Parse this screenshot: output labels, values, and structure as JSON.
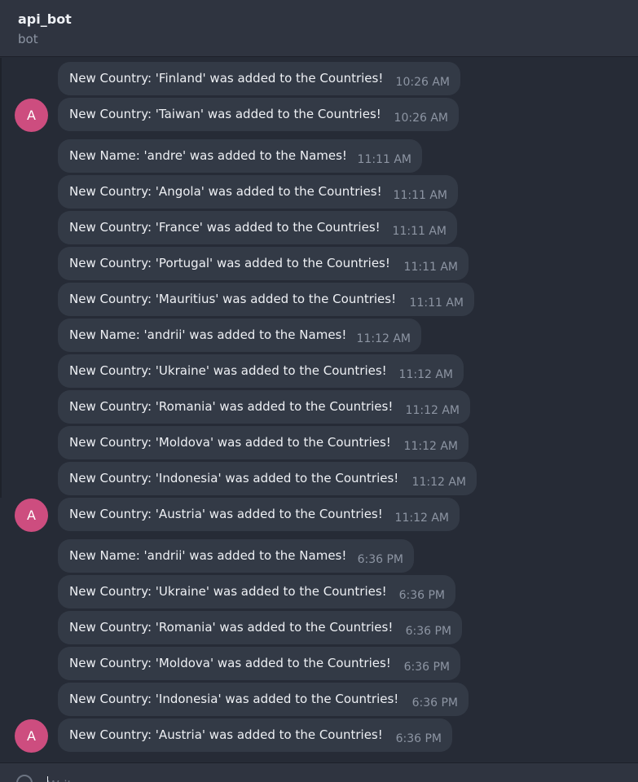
{
  "header": {
    "title": "api_bot",
    "subtitle": "bot"
  },
  "avatar_letter": "A",
  "messages": [
    {
      "text": "New Country: 'Finland' was added to the Countries!",
      "time": "10:26 AM"
    },
    {
      "text": "New Country: 'Taiwan' was added to the Countries!",
      "time": "10:26 AM"
    },
    {
      "text": "New Name: 'andre' was added to the Names!",
      "time": "11:11 AM"
    },
    {
      "text": "New Country: 'Angola' was added to the Countries!",
      "time": "11:11 AM"
    },
    {
      "text": "New Country: 'France' was added to the Countries!",
      "time": "11:11 AM"
    },
    {
      "text": "New Country: 'Portugal' was added to the Countries!",
      "time": "11:11 AM"
    },
    {
      "text": "New Country: 'Mauritius' was added to the Countries!",
      "time": "11:11 AM"
    },
    {
      "text": "New Name: 'andrii' was added to the Names!",
      "time": "11:12 AM"
    },
    {
      "text": "New Country: 'Ukraine' was added to the Countries!",
      "time": "11:12 AM"
    },
    {
      "text": "New Country: 'Romania' was added to the Countries!",
      "time": "11:12 AM"
    },
    {
      "text": "New Country: 'Moldova' was added to the Countries!",
      "time": "11:12 AM"
    },
    {
      "text": "New Country: 'Indonesia' was added to the Countries!",
      "time": "11:12 AM"
    },
    {
      "text": "New Country: 'Austria' was added to the Countries!",
      "time": "11:12 AM"
    },
    {
      "text": "New Name: 'andrii' was added to the Names!",
      "time": "6:36 PM"
    },
    {
      "text": "New Country: 'Ukraine' was added to the Countries!",
      "time": "6:36 PM"
    },
    {
      "text": "New Country: 'Romania' was added to the Countries!",
      "time": "6:36 PM"
    },
    {
      "text": "New Country: 'Moldova' was added to the Countries!",
      "time": "6:36 PM"
    },
    {
      "text": "New Country: 'Indonesia' was added to the Countries!",
      "time": "6:36 PM"
    },
    {
      "text": "New Country: 'Austria' was added to the Countries!",
      "time": "6:36 PM"
    }
  ],
  "composer": {
    "placeholder": "Write a message..."
  }
}
